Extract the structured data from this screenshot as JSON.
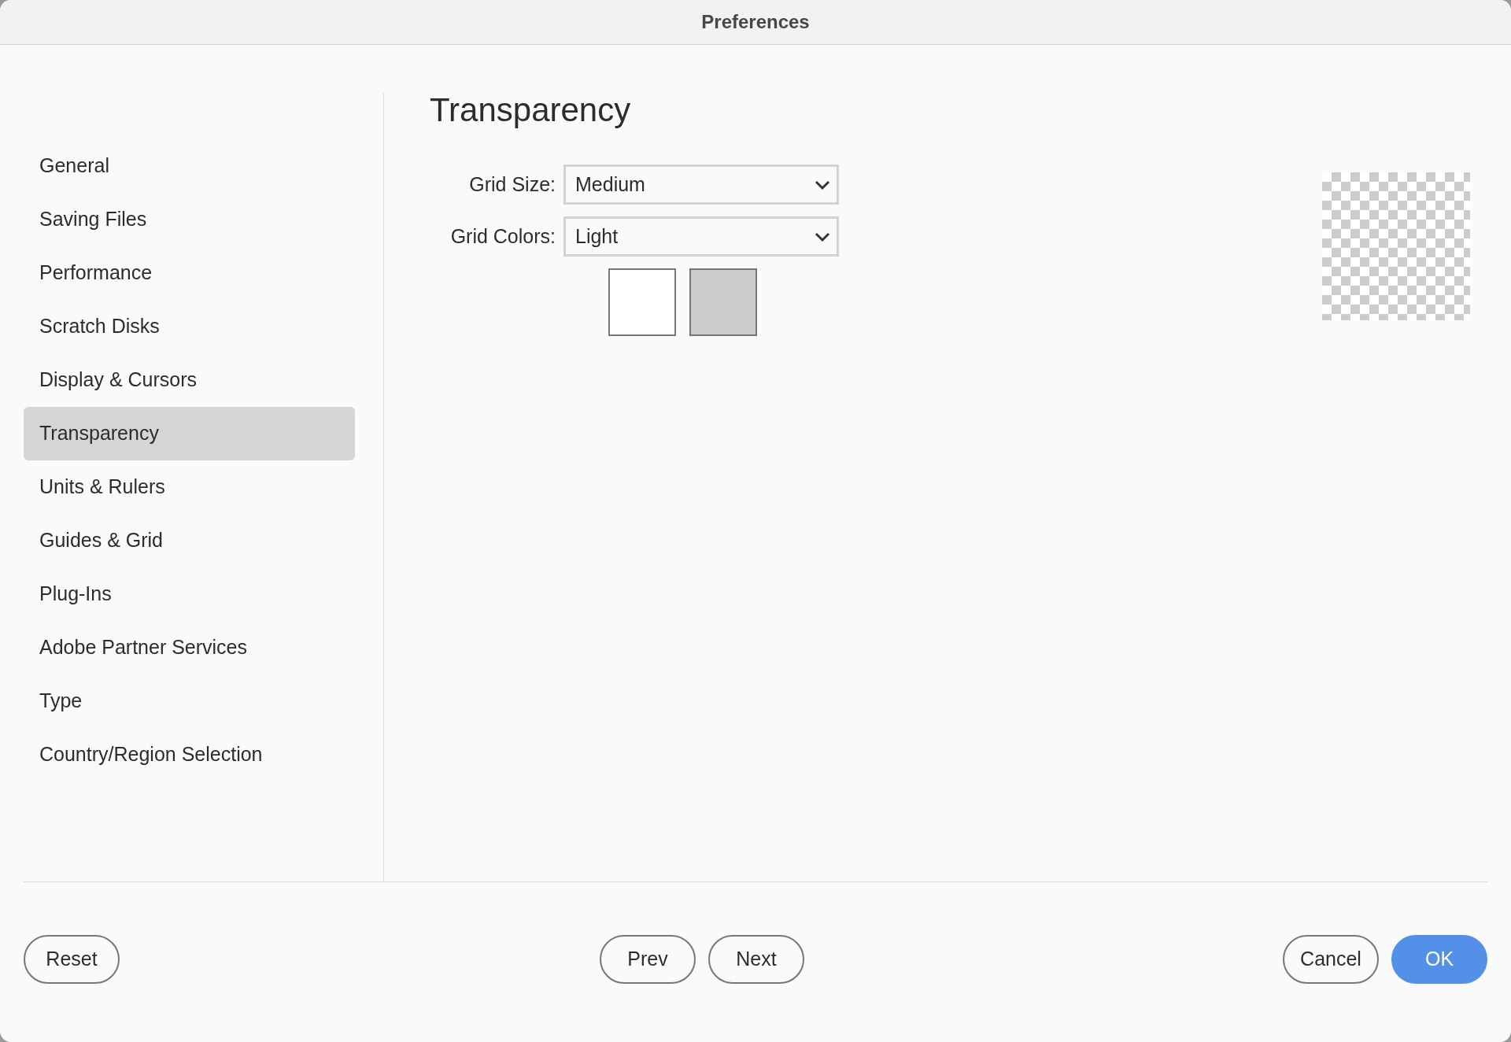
{
  "window": {
    "title": "Preferences"
  },
  "sidebar": {
    "items": [
      {
        "label": "General",
        "selected": false
      },
      {
        "label": "Saving Files",
        "selected": false
      },
      {
        "label": "Performance",
        "selected": false
      },
      {
        "label": "Scratch Disks",
        "selected": false
      },
      {
        "label": "Display & Cursors",
        "selected": false
      },
      {
        "label": "Transparency",
        "selected": true
      },
      {
        "label": "Units & Rulers",
        "selected": false
      },
      {
        "label": "Guides & Grid",
        "selected": false
      },
      {
        "label": "Plug-Ins",
        "selected": false
      },
      {
        "label": "Adobe Partner Services",
        "selected": false
      },
      {
        "label": "Type",
        "selected": false
      },
      {
        "label": "Country/Region Selection",
        "selected": false
      }
    ]
  },
  "panel": {
    "title": "Transparency",
    "fields": [
      {
        "label": "Grid Size:",
        "value": "Medium"
      },
      {
        "label": "Grid Colors:",
        "value": "Light"
      }
    ],
    "swatches": [
      {
        "color": "#ffffff"
      },
      {
        "color": "#cccccc"
      }
    ]
  },
  "buttons": [
    {
      "label": "Reset",
      "kind": "outline"
    },
    {
      "label": "Prev",
      "kind": "outline"
    },
    {
      "label": "Next",
      "kind": "outline"
    },
    {
      "label": "Cancel",
      "kind": "outline"
    },
    {
      "label": "OK",
      "kind": "primary"
    }
  ]
}
